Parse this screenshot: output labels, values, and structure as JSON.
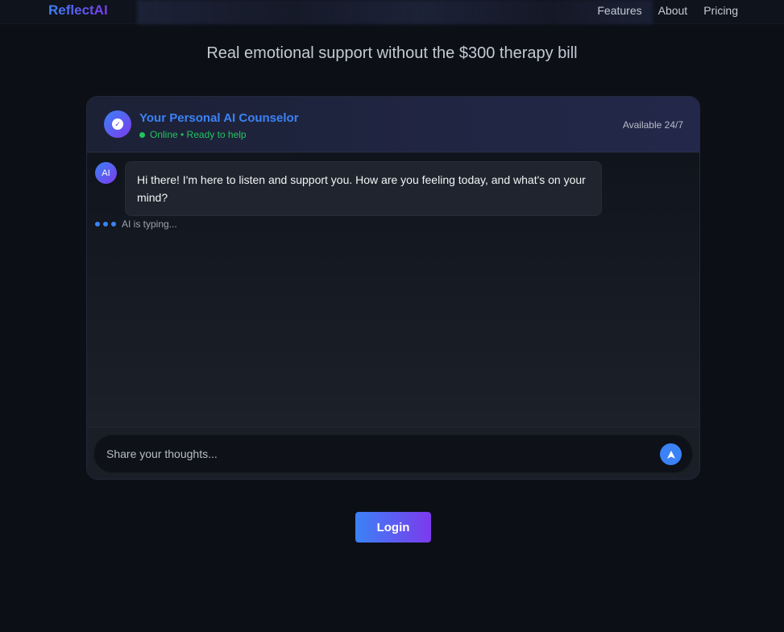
{
  "nav": {
    "brand": "ReflectAI",
    "links": [
      "Features",
      "About",
      "Pricing"
    ]
  },
  "hero": {
    "tagline": "Real emotional support without the $300 therapy bill"
  },
  "chat": {
    "title": "Your Personal AI Counselor",
    "status": "Online • Ready to help",
    "availability": "Available 24/7",
    "ai_avatar_label": "AI",
    "messages": [
      {
        "sender": "AI",
        "text": "Hi there! I'm here to listen and support you. How are you feeling today, and what's on your mind?"
      }
    ],
    "typing_text": "AI is typing...",
    "input_placeholder": "Share your thoughts...",
    "input_value": ""
  },
  "actions": {
    "login_label": "Login"
  },
  "colors": {
    "accent_blue": "#3b82f6",
    "accent_purple": "#7c3aed",
    "status_green": "#22c55e",
    "background": "#0c0f16"
  },
  "icons": {
    "header_avatar": "ai-logo-icon",
    "send": "send-arrow-icon",
    "status": "online-dot-icon"
  }
}
